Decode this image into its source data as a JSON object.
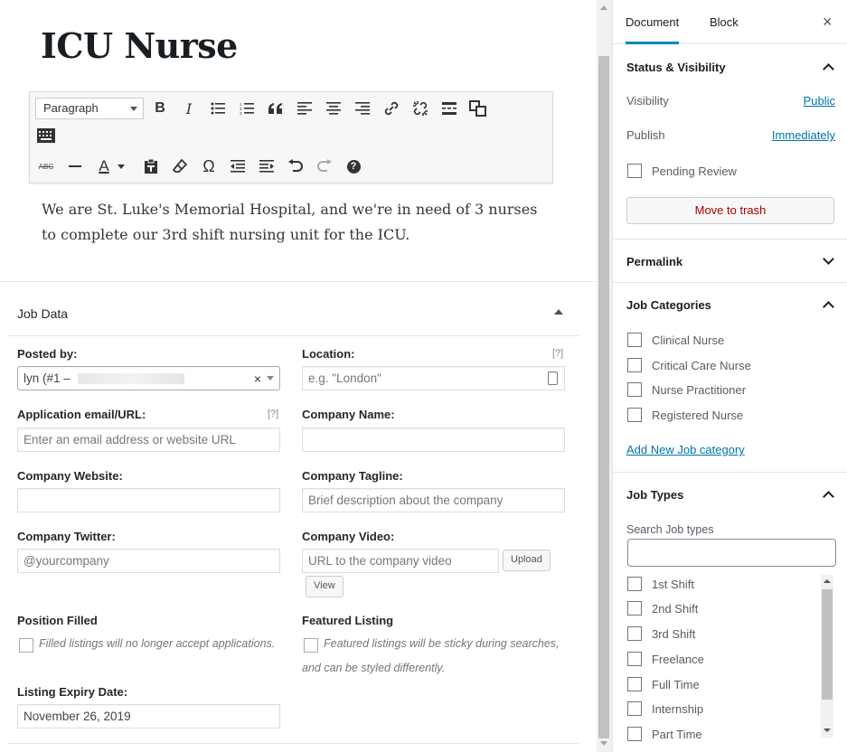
{
  "post": {
    "title": "ICU Nurse",
    "content": "We are St. Luke's Memorial Hospital, and we're in need of 3 nurses to complete our 3rd shift nursing unit for the ICU."
  },
  "toolbar": {
    "format_select": "Paragraph",
    "buttons_row1": [
      "bold-icon",
      "italic-icon",
      "bullet-list-icon",
      "numbered-list-icon",
      "blockquote-icon",
      "align-left-icon",
      "align-center-icon",
      "align-right-icon",
      "link-icon",
      "unlink-icon",
      "read-more-icon",
      "toolbar-toggle-icon",
      "keyboard-icon"
    ],
    "buttons_row2": [
      "strikethrough-icon",
      "horizontal-rule-icon",
      "text-color-icon",
      "paste-text-icon",
      "clear-formatting-icon",
      "special-character-icon",
      "outdent-icon",
      "indent-icon",
      "undo-icon",
      "redo-icon",
      "help-icon"
    ],
    "strike_label": "ABC",
    "bold_label": "B",
    "italic_label": "I",
    "text_color_label": "A",
    "omega_label": "Ω",
    "help_label": "?"
  },
  "job_data": {
    "title": "Job Data",
    "fields": {
      "posted_by": {
        "label": "Posted by:",
        "value": "lyn (#1 –",
        "clear": "×"
      },
      "location": {
        "label": "Location:",
        "placeholder": "e.g. \"London\"",
        "hint": "[?]"
      },
      "application": {
        "label": "Application email/URL:",
        "placeholder": "Enter an email address or website URL",
        "hint": "[?]"
      },
      "company_name": {
        "label": "Company Name:",
        "placeholder": ""
      },
      "company_website": {
        "label": "Company Website:",
        "placeholder": ""
      },
      "company_tagline": {
        "label": "Company Tagline:",
        "placeholder": "Brief description about the company"
      },
      "company_twitter": {
        "label": "Company Twitter:",
        "placeholder": "@yourcompany"
      },
      "company_video": {
        "label": "Company Video:",
        "placeholder": "URL to the company video",
        "upload": "Upload",
        "view": "View"
      },
      "position_filled": {
        "label": "Position Filled",
        "description": "Filled listings will no longer accept applications."
      },
      "featured_listing": {
        "label": "Featured Listing",
        "description_line1": "Featured listings will be sticky during searches,",
        "description_line2": "and can be styled differently."
      },
      "listing_expiry": {
        "label": "Listing Expiry Date:",
        "value": "November 26, 2019"
      }
    }
  },
  "sidebar": {
    "tabs": [
      "Document",
      "Block"
    ],
    "close": "×",
    "status": {
      "title": "Status & Visibility",
      "visibility_label": "Visibility",
      "visibility_value": "Public",
      "publish_label": "Publish",
      "publish_value": "Immediately",
      "pending_review": "Pending Review",
      "trash": "Move to trash"
    },
    "permalink": {
      "title": "Permalink"
    },
    "job_categories": {
      "title": "Job Categories",
      "items": [
        "Clinical Nurse",
        "Critical Care Nurse",
        "Nurse Practitioner",
        "Registered Nurse"
      ],
      "add_link": "Add New Job category"
    },
    "job_types": {
      "title": "Job Types",
      "search_label": "Search Job types",
      "items": [
        "1st Shift",
        "2nd Shift",
        "3rd Shift",
        "Freelance",
        "Full Time",
        "Internship",
        "Part Time"
      ]
    }
  }
}
